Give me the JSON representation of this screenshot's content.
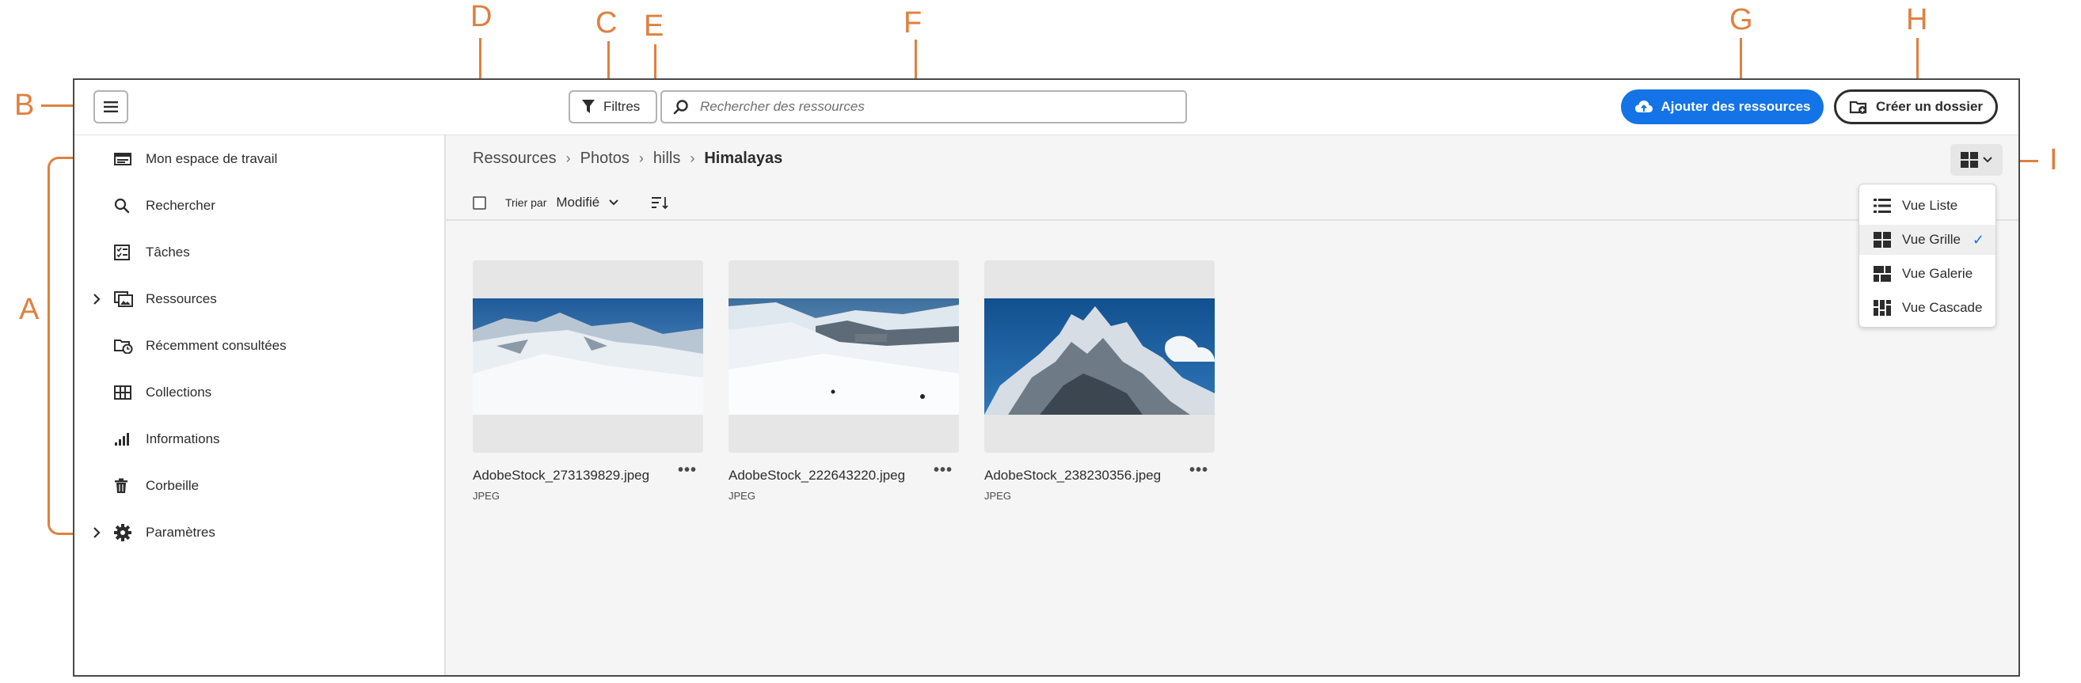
{
  "annotations": {
    "a": "A",
    "b": "B",
    "c": "C",
    "d": "D",
    "e": "E",
    "f": "F",
    "g": "G",
    "h": "H",
    "i": "I"
  },
  "topbar": {
    "menu_icon": "hamburger-icon",
    "filters_label": "Filtres",
    "search_placeholder": "Rechercher des ressources",
    "add_label": "Ajouter des ressources",
    "folder_label": "Créer un dossier"
  },
  "sidebar": {
    "items": [
      {
        "label": "Mon espace de travail",
        "icon": "workspace-icon"
      },
      {
        "label": "Rechercher",
        "icon": "search-icon"
      },
      {
        "label": "Tâches",
        "icon": "tasks-icon"
      },
      {
        "label": "Ressources",
        "icon": "assets-icon",
        "expandable": true
      },
      {
        "label": "Récemment consultées",
        "icon": "recent-icon"
      },
      {
        "label": "Collections",
        "icon": "collections-icon"
      },
      {
        "label": "Informations",
        "icon": "insights-icon"
      },
      {
        "label": "Corbeille",
        "icon": "trash-icon"
      },
      {
        "label": "Paramètres",
        "icon": "settings-icon",
        "expandable": true
      }
    ]
  },
  "breadcrumb": [
    "Ressources",
    "Photos",
    "hills",
    "Himalayas"
  ],
  "sort": {
    "prefix": "Trier par",
    "value": "Modifié"
  },
  "assets": [
    {
      "name": "AdobeStock_273139829.jpeg",
      "type": "JPEG"
    },
    {
      "name": "AdobeStock_222643220.jpeg",
      "type": "JPEG"
    },
    {
      "name": "AdobeStock_238230356.jpeg",
      "type": "JPEG"
    }
  ],
  "view_menu": {
    "items": [
      "Vue Liste",
      "Vue Grille",
      "Vue Galerie",
      "Vue Cascade"
    ],
    "selected": "Vue Grille"
  },
  "colors": {
    "accent": "#1473e6",
    "annotation": "#e0803f"
  }
}
